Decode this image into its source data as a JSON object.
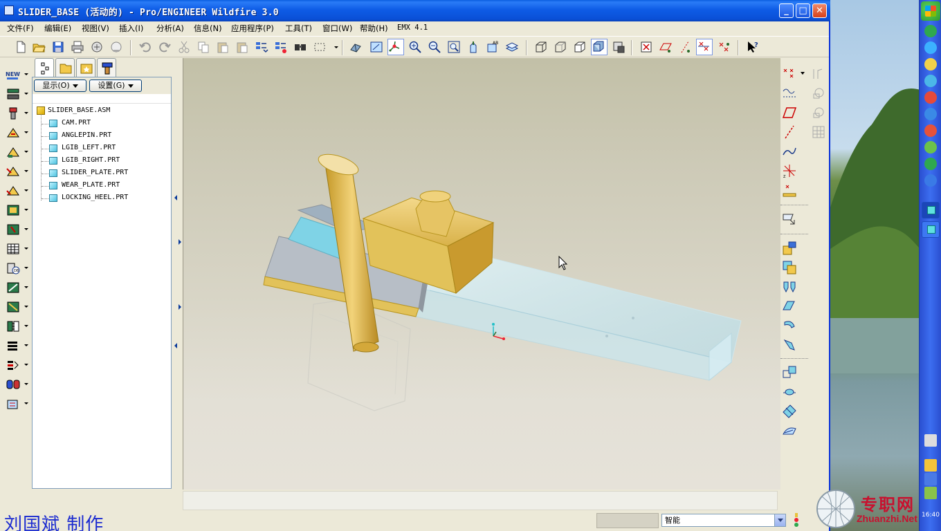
{
  "window": {
    "title": "SLIDER_BASE (活动的) - Pro/ENGINEER Wildfire 3.0",
    "minimize": "_",
    "maximize": "□",
    "close": "✕"
  },
  "menu": [
    "文件(F)",
    "编辑(E)",
    "视图(V)",
    "插入(I)",
    "分析(A)",
    "信息(N)",
    "应用程序(P)",
    "工具(T)",
    "窗口(W)",
    "帮助(H)",
    "EMX 4.1"
  ],
  "navigator": {
    "show_label": "显示(O)",
    "settings_label": "设置(G)",
    "tree": {
      "root": "SLIDER_BASE.ASM",
      "parts": [
        "CAM.PRT",
        "ANGLEPIN.PRT",
        "LGIB_LEFT.PRT",
        "LGIB_RIGHT.PRT",
        "SLIDER_PLATE.PRT",
        "WEAR_PLATE.PRT",
        "LOCKING_HEEL.PRT"
      ]
    }
  },
  "status": {
    "filter_value": "智能",
    "author": "刘国斌  制作"
  },
  "watermark": {
    "cn": "专职网",
    "en": "Zhuanzhi.Net"
  },
  "taskbar": {
    "clock": "16:40"
  },
  "colors": {
    "titlebar": "#0a4fd6",
    "graphics_bg_top": "#c2c0a7",
    "graphics_bg_bottom": "#e6e2d9",
    "part_gold": "#e2c25a",
    "part_gray": "#a9afb6",
    "part_cyan": "#7fd3e6",
    "author_text": "#1a2ad0",
    "watermark": "#c8102e"
  },
  "icons": {
    "toolbar": [
      "new-icon",
      "open-icon",
      "save-icon",
      "print-icon",
      "send-icon",
      "close-window-icon",
      "undo-icon",
      "redo-icon",
      "cut-icon",
      "copy-icon",
      "paste-icon",
      "paste-special-icon",
      "regenerate-icon",
      "regenerate-manager-icon",
      "find-icon",
      "select-box-icon",
      "orient-icon",
      "refit-icon",
      "spin-center-icon",
      "zoom-in-icon",
      "zoom-out-icon",
      "zoom-fit-icon",
      "reorient-icon",
      "view-manager-icon",
      "layers-icon",
      "wireframe-icon",
      "hidden-line-icon",
      "no-hidden-icon",
      "shading-icon",
      "appearance-icon",
      "datum-planes-toggle-icon",
      "datum-axes-toggle-icon",
      "datum-points-toggle-icon",
      "csys-toggle-icon",
      "annotations-toggle-icon",
      "context-help-icon"
    ],
    "left": [
      "new-component-icon",
      "assemble-icon",
      "hole-icon",
      "extrude-icon",
      "revolve-icon",
      "sweep-icon",
      "blend-icon",
      "round-icon",
      "chamfer-icon",
      "shell-icon",
      "rib-icon",
      "draft-icon",
      "pattern-icon",
      "mirror-icon",
      "merge-icon",
      "trim-icon",
      "cut-icon",
      "repeat-icon"
    ],
    "right": [
      "datum-point-icon",
      "datum-curve-icon",
      "datum-plane-icon",
      "datum-axis-icon",
      "sketch-curve-icon",
      "csys-icon",
      "analysis-icon",
      "annotation-icon",
      "insert-component-icon",
      "copy-geom-icon",
      "merge-feature-icon",
      "boundary-blend-icon",
      "fill-icon",
      "offset-icon",
      "extend-icon",
      "intersect-icon",
      "project-icon",
      "wrap-icon"
    ]
  }
}
